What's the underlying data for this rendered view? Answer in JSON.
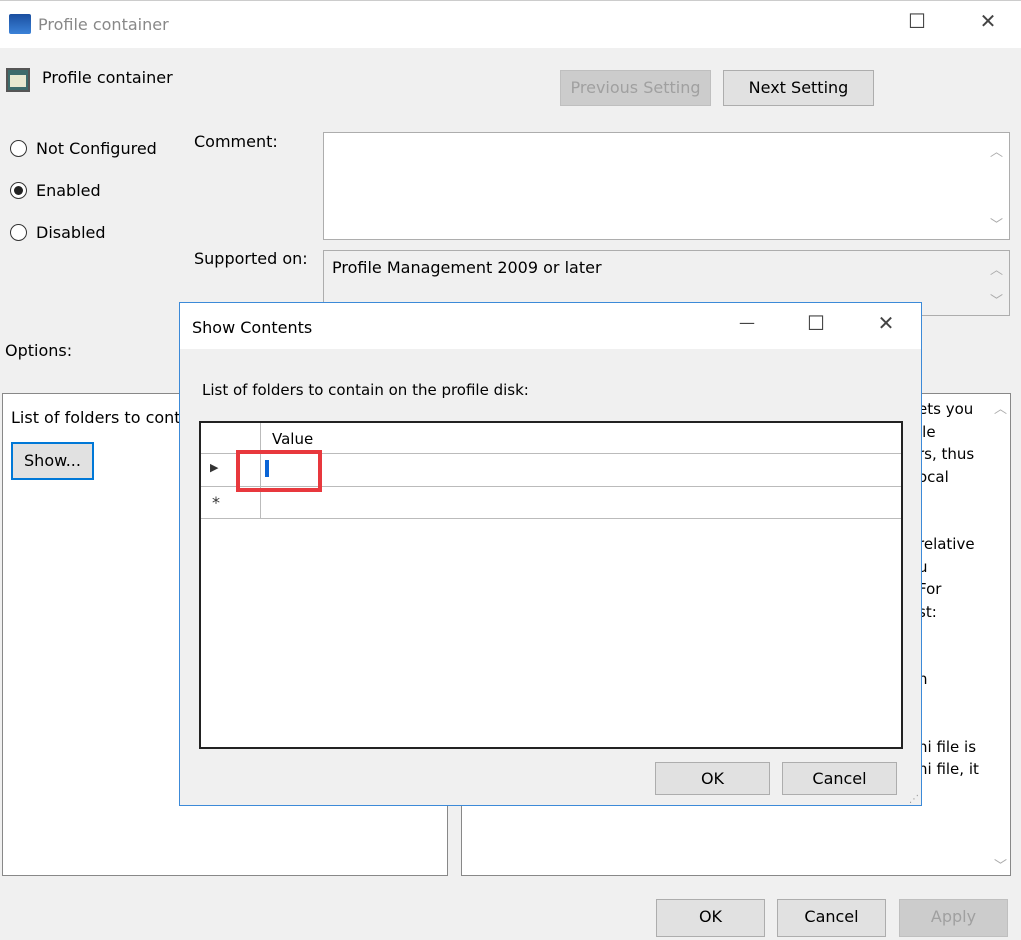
{
  "window": {
    "title": "Profile container",
    "minimize": "—",
    "maximize": "☐",
    "close": "✕"
  },
  "header": {
    "policy_title": "Profile container",
    "previous_setting": "Previous Setting",
    "next_setting": "Next Setting"
  },
  "state": {
    "options": [
      {
        "label": "Not Configured",
        "selected": false
      },
      {
        "label": "Enabled",
        "selected": true
      },
      {
        "label": "Disabled",
        "selected": false
      }
    ]
  },
  "comment": {
    "label": "Comment:",
    "value": ""
  },
  "supported": {
    "label": "Supported on:",
    "value": "Profile Management 2009 or later"
  },
  "options": {
    "label": "Options:",
    "list_label": "List of folders to cont",
    "show_button": "Show..."
  },
  "help": {
    "fragments": [
      "ets you",
      "ile",
      "rs, thus",
      "ocal",
      "",
      "",
      "relative",
      "u",
      "For",
      "st:",
      "",
      "",
      "n",
      "",
      "",
      "ni file is",
      "ni file, it"
    ]
  },
  "footer": {
    "ok": "OK",
    "cancel": "Cancel",
    "apply": "Apply"
  },
  "dialog": {
    "title": "Show Contents",
    "minimize": "—",
    "maximize": "☐",
    "close": "✕",
    "list_label": "List of folders to contain on the profile disk:",
    "column_header": "Value",
    "rows": [
      {
        "marker": "▶",
        "value": ""
      },
      {
        "marker": "*",
        "value": ""
      }
    ],
    "ok": "OK",
    "cancel": "Cancel",
    "highlight_color": "#e8383d"
  }
}
